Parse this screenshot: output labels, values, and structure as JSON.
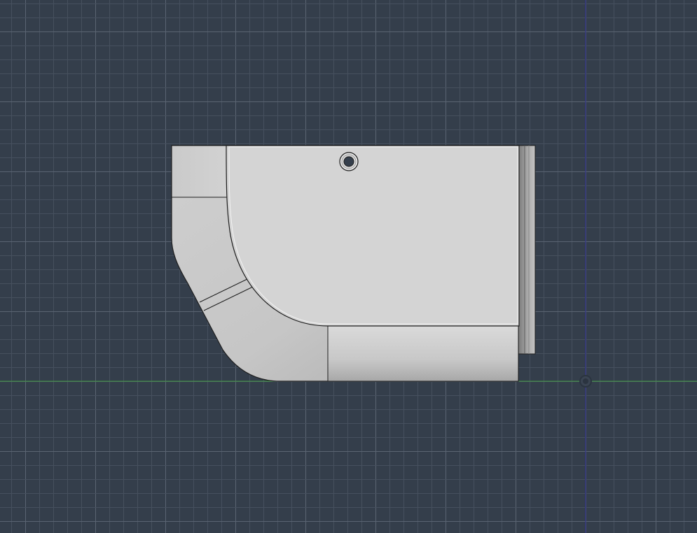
{
  "app": "cad-viewport",
  "view": {
    "background_color": "#343e4b",
    "grid_minor_color": "#46505e",
    "grid_major_color": "#5a6472",
    "x_axis_color": "#3c9a3c",
    "y_axis_color": "#2a2a8c",
    "grid_visible": true
  },
  "model": {
    "name": "part",
    "face_color": "#d4d4d4",
    "edge_color": "#1e1e1e",
    "icons": [
      "origin-icon",
      "hole-icon"
    ]
  }
}
